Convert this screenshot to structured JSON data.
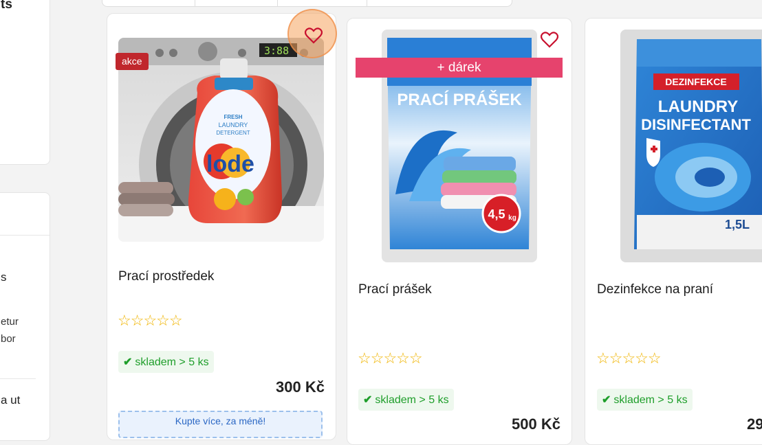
{
  "sidebar": {
    "heading_fragment": "ts",
    "section_fragment": "s",
    "text_line_1": "etur",
    "text_line_2": "bor",
    "bottom_fragment": "a ut"
  },
  "products": [
    {
      "name": "Prací prostředek",
      "badge": "akce",
      "stars": "☆☆☆☆☆",
      "stock": "skladem > 5 ks",
      "price": "300 Kč",
      "promo": "Kupte více, za méně!",
      "image_text": {
        "brand": "lode",
        "line1": "FRESH",
        "line2": "LAUNDRY",
        "line3": "DETERGENT",
        "display": "3:88"
      }
    },
    {
      "name": "Prací prášek",
      "gift": "+ dárek",
      "stars": "☆☆☆☆☆",
      "stock": "skladem > 5 ks",
      "price": "500 Kč",
      "image_text": {
        "title": "PRACÍ PRÁŠEK",
        "weight": "4,5",
        "unit": "kg"
      }
    },
    {
      "name": "Dezinfekce na praní",
      "stars": "☆☆☆☆☆",
      "stock": "skladem > 5 ks",
      "price": "29",
      "image_text": {
        "banner": "DEZINFEKCE",
        "line1": "LAUNDRY",
        "line2": "DISINFECTANT",
        "volume": "1,5L"
      }
    }
  ],
  "icons": {
    "heart": "heart-outline-icon",
    "check": "check-icon",
    "star": "star-outline-icon"
  },
  "colors": {
    "accent_red": "#c0272d",
    "gift_pink": "#e6436d",
    "stock_green": "#1e9e2a",
    "star_gold": "#f0b400"
  }
}
